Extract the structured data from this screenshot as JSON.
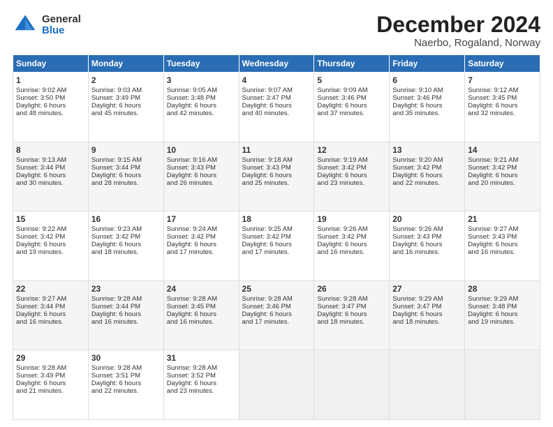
{
  "logo": {
    "general": "General",
    "blue": "Blue"
  },
  "title": "December 2024",
  "location": "Naerbo, Rogaland, Norway",
  "days_header": [
    "Sunday",
    "Monday",
    "Tuesday",
    "Wednesday",
    "Thursday",
    "Friday",
    "Saturday"
  ],
  "weeks": [
    [
      {
        "day": "1",
        "lines": [
          "Sunrise: 9:02 AM",
          "Sunset: 3:50 PM",
          "Daylight: 6 hours",
          "and 48 minutes."
        ]
      },
      {
        "day": "2",
        "lines": [
          "Sunrise: 9:03 AM",
          "Sunset: 3:49 PM",
          "Daylight: 6 hours",
          "and 45 minutes."
        ]
      },
      {
        "day": "3",
        "lines": [
          "Sunrise: 9:05 AM",
          "Sunset: 3:48 PM",
          "Daylight: 6 hours",
          "and 42 minutes."
        ]
      },
      {
        "day": "4",
        "lines": [
          "Sunrise: 9:07 AM",
          "Sunset: 3:47 PM",
          "Daylight: 6 hours",
          "and 40 minutes."
        ]
      },
      {
        "day": "5",
        "lines": [
          "Sunrise: 9:09 AM",
          "Sunset: 3:46 PM",
          "Daylight: 6 hours",
          "and 37 minutes."
        ]
      },
      {
        "day": "6",
        "lines": [
          "Sunrise: 9:10 AM",
          "Sunset: 3:46 PM",
          "Daylight: 6 hours",
          "and 35 minutes."
        ]
      },
      {
        "day": "7",
        "lines": [
          "Sunrise: 9:12 AM",
          "Sunset: 3:45 PM",
          "Daylight: 6 hours",
          "and 32 minutes."
        ]
      }
    ],
    [
      {
        "day": "8",
        "lines": [
          "Sunrise: 9:13 AM",
          "Sunset: 3:44 PM",
          "Daylight: 6 hours",
          "and 30 minutes."
        ]
      },
      {
        "day": "9",
        "lines": [
          "Sunrise: 9:15 AM",
          "Sunset: 3:44 PM",
          "Daylight: 6 hours",
          "and 28 minutes."
        ]
      },
      {
        "day": "10",
        "lines": [
          "Sunrise: 9:16 AM",
          "Sunset: 3:43 PM",
          "Daylight: 6 hours",
          "and 26 minutes."
        ]
      },
      {
        "day": "11",
        "lines": [
          "Sunrise: 9:18 AM",
          "Sunset: 3:43 PM",
          "Daylight: 6 hours",
          "and 25 minutes."
        ]
      },
      {
        "day": "12",
        "lines": [
          "Sunrise: 9:19 AM",
          "Sunset: 3:42 PM",
          "Daylight: 6 hours",
          "and 23 minutes."
        ]
      },
      {
        "day": "13",
        "lines": [
          "Sunrise: 9:20 AM",
          "Sunset: 3:42 PM",
          "Daylight: 6 hours",
          "and 22 minutes."
        ]
      },
      {
        "day": "14",
        "lines": [
          "Sunrise: 9:21 AM",
          "Sunset: 3:42 PM",
          "Daylight: 6 hours",
          "and 20 minutes."
        ]
      }
    ],
    [
      {
        "day": "15",
        "lines": [
          "Sunrise: 9:22 AM",
          "Sunset: 3:42 PM",
          "Daylight: 6 hours",
          "and 19 minutes."
        ]
      },
      {
        "day": "16",
        "lines": [
          "Sunrise: 9:23 AM",
          "Sunset: 3:42 PM",
          "Daylight: 6 hours",
          "and 18 minutes."
        ]
      },
      {
        "day": "17",
        "lines": [
          "Sunrise: 9:24 AM",
          "Sunset: 3:42 PM",
          "Daylight: 6 hours",
          "and 17 minutes."
        ]
      },
      {
        "day": "18",
        "lines": [
          "Sunrise: 9:25 AM",
          "Sunset: 3:42 PM",
          "Daylight: 6 hours",
          "and 17 minutes."
        ]
      },
      {
        "day": "19",
        "lines": [
          "Sunrise: 9:26 AM",
          "Sunset: 3:42 PM",
          "Daylight: 6 hours",
          "and 16 minutes."
        ]
      },
      {
        "day": "20",
        "lines": [
          "Sunrise: 9:26 AM",
          "Sunset: 3:43 PM",
          "Daylight: 6 hours",
          "and 16 minutes."
        ]
      },
      {
        "day": "21",
        "lines": [
          "Sunrise: 9:27 AM",
          "Sunset: 3:43 PM",
          "Daylight: 6 hours",
          "and 16 minutes."
        ]
      }
    ],
    [
      {
        "day": "22",
        "lines": [
          "Sunrise: 9:27 AM",
          "Sunset: 3:44 PM",
          "Daylight: 6 hours",
          "and 16 minutes."
        ]
      },
      {
        "day": "23",
        "lines": [
          "Sunrise: 9:28 AM",
          "Sunset: 3:44 PM",
          "Daylight: 6 hours",
          "and 16 minutes."
        ]
      },
      {
        "day": "24",
        "lines": [
          "Sunrise: 9:28 AM",
          "Sunset: 3:45 PM",
          "Daylight: 6 hours",
          "and 16 minutes."
        ]
      },
      {
        "day": "25",
        "lines": [
          "Sunrise: 9:28 AM",
          "Sunset: 3:46 PM",
          "Daylight: 6 hours",
          "and 17 minutes."
        ]
      },
      {
        "day": "26",
        "lines": [
          "Sunrise: 9:28 AM",
          "Sunset: 3:47 PM",
          "Daylight: 6 hours",
          "and 18 minutes."
        ]
      },
      {
        "day": "27",
        "lines": [
          "Sunrise: 9:29 AM",
          "Sunset: 3:47 PM",
          "Daylight: 6 hours",
          "and 18 minutes."
        ]
      },
      {
        "day": "28",
        "lines": [
          "Sunrise: 9:29 AM",
          "Sunset: 3:48 PM",
          "Daylight: 6 hours",
          "and 19 minutes."
        ]
      }
    ],
    [
      {
        "day": "29",
        "lines": [
          "Sunrise: 9:28 AM",
          "Sunset: 3:49 PM",
          "Daylight: 6 hours",
          "and 21 minutes."
        ]
      },
      {
        "day": "30",
        "lines": [
          "Sunrise: 9:28 AM",
          "Sunset: 3:51 PM",
          "Daylight: 6 hours",
          "and 22 minutes."
        ]
      },
      {
        "day": "31",
        "lines": [
          "Sunrise: 9:28 AM",
          "Sunset: 3:52 PM",
          "Daylight: 6 hours",
          "and 23 minutes."
        ]
      },
      {
        "day": "",
        "lines": []
      },
      {
        "day": "",
        "lines": []
      },
      {
        "day": "",
        "lines": []
      },
      {
        "day": "",
        "lines": []
      }
    ]
  ]
}
